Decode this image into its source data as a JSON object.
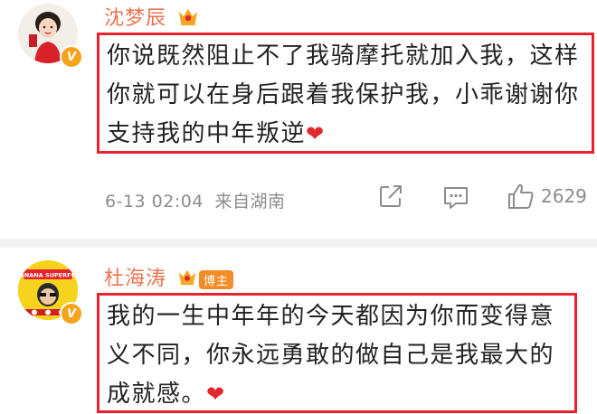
{
  "comments": [
    {
      "username": "沈梦辰",
      "badge": "V",
      "lines": [
        "你说既然阻止不了我骑摩托就加入我，这样",
        "你就可以在身后跟着我保护我，小乖谢谢你",
        "支持我的中年叛逆"
      ],
      "date": "6-13 02:04",
      "source": "来自湖南",
      "like_count": "2629"
    },
    {
      "username": "杜海涛",
      "badge": "V",
      "tag": "博主",
      "avatar_text": "BANANA SUPERFUN",
      "lines": [
        "我的一生中年年的今天都因为你而变得意",
        "义不同，你永远勇敢的做自己是我最大的",
        "成就感。"
      ]
    }
  ],
  "icons": {
    "heart": "❤",
    "share": "share-icon",
    "comment": "comment-icon",
    "like": "thumbs-up-icon",
    "crown": "crown-icon"
  },
  "colors": {
    "username": "#eb7350",
    "highlight_border": "#e8222e",
    "heart": "#e5262c",
    "meta": "#8c8c8c",
    "verified": "#f7a41c"
  }
}
